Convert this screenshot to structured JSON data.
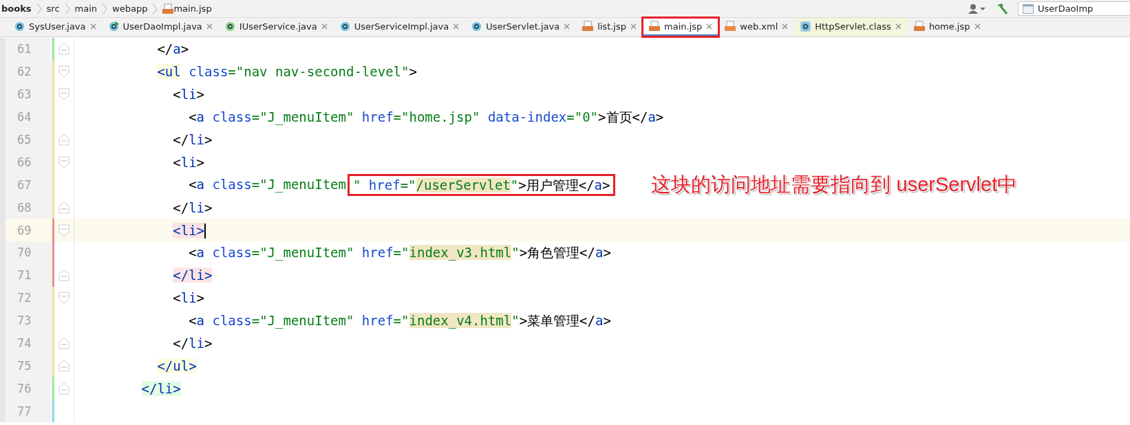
{
  "breadcrumb": [
    {
      "label": "books",
      "kind": "folder"
    },
    {
      "label": "src",
      "kind": "folder"
    },
    {
      "label": "main",
      "kind": "folder"
    },
    {
      "label": "webapp",
      "kind": "folder"
    },
    {
      "label": "main.jsp",
      "kind": "jsp"
    }
  ],
  "run_config": {
    "label": "UserDaoImp"
  },
  "tabs": [
    {
      "label": "SysUser.java",
      "kind": "class",
      "selected": false,
      "marked": false
    },
    {
      "label": "UserDaoImpl.java",
      "kind": "runnable",
      "selected": false,
      "marked": false
    },
    {
      "label": "IUserService.java",
      "kind": "interface",
      "selected": false,
      "marked": false
    },
    {
      "label": "UserServiceImpl.java",
      "kind": "class",
      "selected": false,
      "marked": false
    },
    {
      "label": "UserServlet.java",
      "kind": "class",
      "selected": false,
      "marked": false
    },
    {
      "label": "list.jsp",
      "kind": "jsp",
      "selected": false,
      "marked": false
    },
    {
      "label": "main.jsp",
      "kind": "jsp",
      "selected": true,
      "marked": true
    },
    {
      "label": "web.xml",
      "kind": "xml",
      "selected": false,
      "marked": false
    },
    {
      "label": "HttpServlet.class",
      "kind": "library",
      "selected": false,
      "marked": false
    },
    {
      "label": "home.jsp",
      "kind": "jsp",
      "selected": false,
      "marked": false
    }
  ],
  "lines": [
    {
      "number": "61",
      "color": "#9fe59f",
      "fold_start": false,
      "fold_end": true,
      "current": false,
      "tokens": [
        {
          "text": "          </",
          "kind": "punct"
        },
        {
          "text": "a",
          "kind": "tag"
        },
        {
          "text": ">",
          "kind": "punct"
        }
      ]
    },
    {
      "number": "62",
      "color": "#e9e29d",
      "fold_start": true,
      "fold_end": false,
      "current": false,
      "tokens": [
        {
          "text": "          <ul",
          "kind": "tag",
          "color": "#fbfbe0"
        },
        {
          "text": " class",
          "kind": "attr"
        },
        {
          "text": "=\"nav nav-second-level\"",
          "kind": "value"
        },
        {
          "text": ">",
          "kind": "punct"
        }
      ]
    },
    {
      "number": "63",
      "color": "#e9e29d",
      "fold_start": true,
      "fold_end": false,
      "current": false,
      "tokens": [
        {
          "text": "            <",
          "kind": "punct"
        },
        {
          "text": "li",
          "kind": "tag"
        },
        {
          "text": ">",
          "kind": "punct"
        }
      ]
    },
    {
      "number": "64",
      "color": "#e9e29d",
      "fold_start": false,
      "fold_end": false,
      "current": false,
      "tokens": [
        {
          "text": "              <",
          "kind": "punct"
        },
        {
          "text": "a",
          "kind": "tag"
        },
        {
          "text": " class",
          "kind": "attr"
        },
        {
          "text": "=\"J_menuItem\"",
          "kind": "value"
        },
        {
          "text": " href",
          "kind": "attr"
        },
        {
          "text": "=\"home.jsp\"",
          "kind": "value"
        },
        {
          "text": " data-index",
          "kind": "attr"
        },
        {
          "text": "=\"0\"",
          "kind": "value"
        },
        {
          "text": ">首页</",
          "kind": "punct"
        },
        {
          "text": "a",
          "kind": "tag"
        },
        {
          "text": ">",
          "kind": "punct"
        }
      ]
    },
    {
      "number": "65",
      "color": "#e9e29d",
      "fold_start": false,
      "fold_end": true,
      "current": false,
      "tokens": [
        {
          "text": "            </",
          "kind": "punct"
        },
        {
          "text": "li",
          "kind": "tag"
        },
        {
          "text": ">",
          "kind": "punct"
        }
      ]
    },
    {
      "number": "66",
      "color": "#e9e29d",
      "fold_start": true,
      "fold_end": false,
      "current": false,
      "tokens": [
        {
          "text": "            <",
          "kind": "punct"
        },
        {
          "text": "li",
          "kind": "tag"
        },
        {
          "text": ">",
          "kind": "punct"
        }
      ]
    },
    {
      "number": "67",
      "color": "#e9e29d",
      "fold_start": false,
      "fold_end": false,
      "current": false,
      "annotation": "这块的访问地址需要指向到 userServlet中",
      "tokens": [
        {
          "text": "              <",
          "kind": "punct"
        },
        {
          "text": "a",
          "kind": "tag"
        },
        {
          "text": " class",
          "kind": "attr"
        },
        {
          "text": "=\"J_menuItem",
          "kind": "value"
        }
      ],
      "boxed_tokens": [
        {
          "text": "\"",
          "kind": "value"
        },
        {
          "text": " href",
          "kind": "attr"
        },
        {
          "text": "=\"",
          "kind": "value"
        },
        {
          "text": "/userServlet",
          "kind": "value",
          "color": "#f1e6c4"
        },
        {
          "text": "\"",
          "kind": "value"
        },
        {
          "text": ">用户管理</",
          "kind": "punct"
        },
        {
          "text": "a",
          "kind": "tag"
        },
        {
          "text": ">",
          "kind": "punct"
        }
      ]
    },
    {
      "number": "68",
      "color": "#e9e29d",
      "fold_start": false,
      "fold_end": true,
      "current": false,
      "tokens": [
        {
          "text": "            </",
          "kind": "punct"
        },
        {
          "text": "li",
          "kind": "tag"
        },
        {
          "text": ">",
          "kind": "punct"
        }
      ]
    },
    {
      "number": "69",
      "color": "#e88f8f",
      "fold_start": true,
      "fold_end": false,
      "current": true,
      "tokens": [
        {
          "text": "            <li>",
          "kind": "tag",
          "color": "#fde4e4"
        }
      ]
    },
    {
      "number": "70",
      "color": "#e88f8f",
      "fold_start": false,
      "fold_end": false,
      "current": false,
      "tokens": [
        {
          "text": "              <",
          "kind": "punct"
        },
        {
          "text": "a",
          "kind": "tag"
        },
        {
          "text": " class",
          "kind": "attr"
        },
        {
          "text": "=\"J_menuItem\"",
          "kind": "value"
        },
        {
          "text": " href",
          "kind": "attr"
        },
        {
          "text": "=\"",
          "kind": "value"
        },
        {
          "text": "index_v3.html",
          "kind": "value",
          "color": "#f1e6c4"
        },
        {
          "text": "\"",
          "kind": "value"
        },
        {
          "text": ">角色管理</",
          "kind": "punct"
        },
        {
          "text": "a",
          "kind": "tag"
        },
        {
          "text": ">",
          "kind": "punct"
        }
      ]
    },
    {
      "number": "71",
      "color": "#e88f8f",
      "fold_start": false,
      "fold_end": true,
      "current": false,
      "tokens": [
        {
          "text": "            </li>",
          "kind": "tag",
          "color": "#fde4e4"
        }
      ]
    },
    {
      "number": "72",
      "color": "#e9e29d",
      "fold_start": true,
      "fold_end": false,
      "current": false,
      "tokens": [
        {
          "text": "            <",
          "kind": "punct"
        },
        {
          "text": "li",
          "kind": "tag"
        },
        {
          "text": ">",
          "kind": "punct"
        }
      ]
    },
    {
      "number": "73",
      "color": "#e9e29d",
      "fold_start": false,
      "fold_end": false,
      "current": false,
      "tokens": [
        {
          "text": "              <",
          "kind": "punct"
        },
        {
          "text": "a",
          "kind": "tag"
        },
        {
          "text": " class",
          "kind": "attr"
        },
        {
          "text": "=\"J_menuItem\"",
          "kind": "value"
        },
        {
          "text": " href",
          "kind": "attr"
        },
        {
          "text": "=\"",
          "kind": "value"
        },
        {
          "text": "index_v4.html",
          "kind": "value",
          "color": "#f1e6c4"
        },
        {
          "text": "\"",
          "kind": "value"
        },
        {
          "text": ">菜单管理</",
          "kind": "punct"
        },
        {
          "text": "a",
          "kind": "tag"
        },
        {
          "text": ">",
          "kind": "punct"
        }
      ]
    },
    {
      "number": "74",
      "color": "#e9e29d",
      "fold_start": false,
      "fold_end": true,
      "current": false,
      "tokens": [
        {
          "text": "            </",
          "kind": "punct"
        },
        {
          "text": "li",
          "kind": "tag"
        },
        {
          "text": ">",
          "kind": "punct"
        }
      ]
    },
    {
      "number": "75",
      "color": "#e9e29d",
      "fold_start": false,
      "fold_end": true,
      "current": false,
      "tokens": [
        {
          "text": "          </ul>",
          "kind": "tag",
          "color": "#fbfbe0"
        }
      ]
    },
    {
      "number": "76",
      "color": "#9fe59f",
      "fold_start": false,
      "fold_end": true,
      "current": false,
      "tokens": [
        {
          "text": "        </li>",
          "kind": "tag",
          "color": "#e3fbe3"
        }
      ]
    },
    {
      "number": "77",
      "color": "#8fdce8",
      "fold_start": false,
      "fold_end": false,
      "current": false
    }
  ]
}
